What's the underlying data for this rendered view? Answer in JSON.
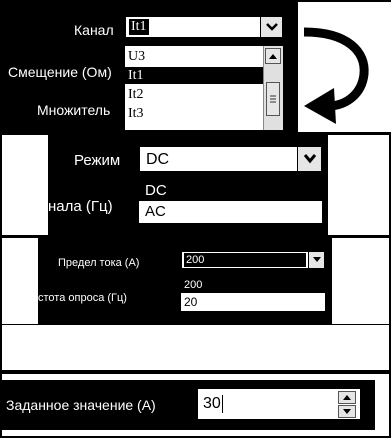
{
  "panel1": {
    "label_channel": "Канал",
    "label_offset": "Смещение (Ом)",
    "label_multiplier": "Множитель",
    "channel_value": "It1",
    "channel_options": [
      "U3",
      "It1",
      "It2",
      "It3"
    ]
  },
  "panel2": {
    "label_mode": "Режим",
    "label_rate": "нала (Гц)",
    "mode_value": "DC",
    "mode_options": [
      "DC",
      "AC"
    ]
  },
  "panel3": {
    "label_range": "Предел тока (А)",
    "label_rate": "стота опроса (Гц)",
    "range_value": "200",
    "range_options": [
      "200",
      "20"
    ]
  },
  "panel4": {
    "label_setpoint": "Заданное значение (А)",
    "setpoint_value": "30"
  },
  "icons": {
    "arrow": "curved-arrow-icon",
    "dropdown": "chevron-down-icon",
    "spin_up": "spin-up-icon",
    "spin_down": "spin-down-icon"
  }
}
